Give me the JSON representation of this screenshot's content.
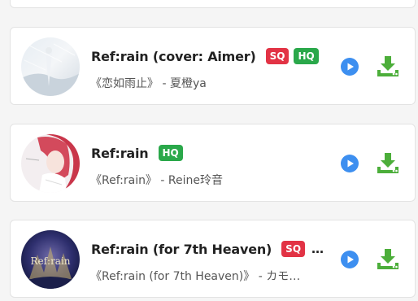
{
  "songs": [
    {
      "title": "Ref:rain (cover: Aimer)",
      "subtitle": "《恋如雨止》 - 夏橙ya",
      "badges": [
        "SQ",
        "HQ"
      ],
      "truncated": false
    },
    {
      "title": "Ref:rain",
      "subtitle": "《Ref:rain》 - Reine玲音",
      "badges": [
        "HQ"
      ],
      "truncated": false
    },
    {
      "title": "Ref:rain (for 7th Heaven)",
      "subtitle": "《Ref:rain (for 7th Heaven)》 - カモ…",
      "badges": [
        "SQ"
      ],
      "truncated": true,
      "title_overflow": "…",
      "cover_text": "Ref:rain"
    }
  ],
  "colors": {
    "play": "#3d8ff0",
    "download": "#4cae3a",
    "sq_badge": "#e23345",
    "hq_badge": "#2aa84a"
  },
  "icons": {
    "play": "play-circle-icon",
    "download": "download-icon"
  }
}
